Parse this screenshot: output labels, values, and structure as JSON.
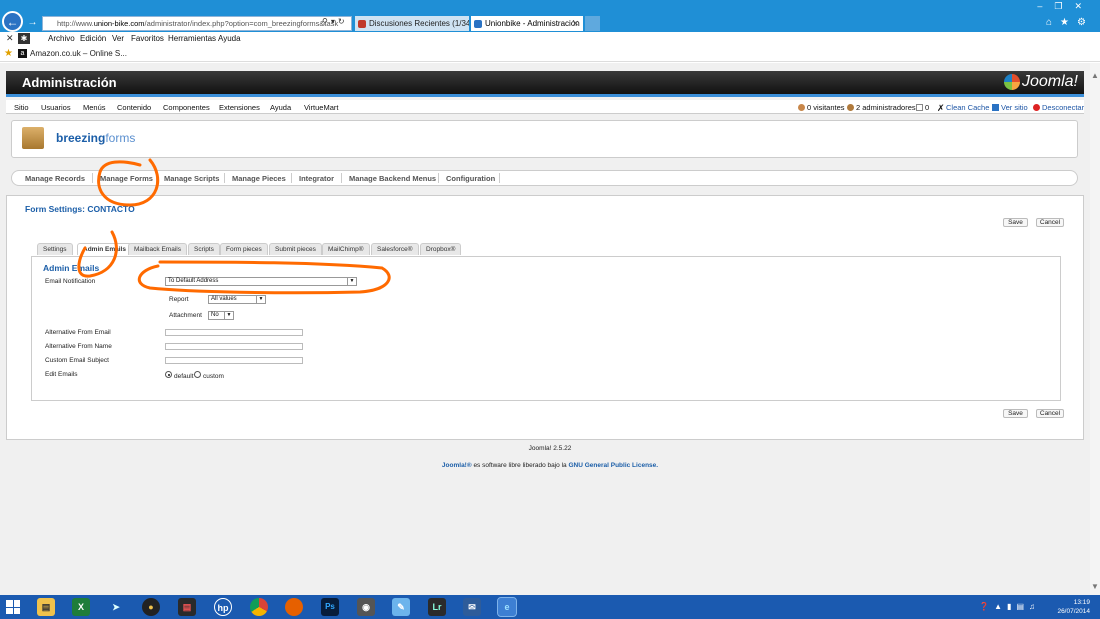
{
  "browser": {
    "url_prefix": "http://www.",
    "url_host": "union-bike.com",
    "url_rest": "/administrator/index.php?option=com_breezingforms&task",
    "tabs": [
      {
        "label": "Discusiones Recientes (1/34) - ..."
      },
      {
        "label": "Unionbike - Administración"
      }
    ],
    "menu": [
      "Archivo",
      "Edición",
      "Ver",
      "Favoritos",
      "Herramientas",
      "Ayuda"
    ],
    "favorite": "Amazon.co.uk – Online S..."
  },
  "admin": {
    "title": "Administración",
    "logo_text": "Joomla!",
    "nav": [
      "Sitio",
      "Usuarios",
      "Menús",
      "Contenido",
      "Componentes",
      "Extensiones",
      "Ayuda",
      "VirtueMart"
    ],
    "status": {
      "visitors": "0 visitantes",
      "admins": "2 administradores",
      "messages": "0",
      "clean_cache": "Clean Cache",
      "view_site": "Ver sitio",
      "logout": "Desconectar"
    }
  },
  "component": {
    "logo_bold": "breezing",
    "logo_thin": "forms",
    "subnav": [
      "Manage Records",
      "Manage Forms",
      "Manage Scripts",
      "Manage Pieces",
      "Integrator",
      "Manage Backend Menus",
      "Configuration"
    ]
  },
  "form": {
    "title": "Form Settings: CONTACTO",
    "save_label": "Save",
    "cancel_label": "Cancel",
    "tabs": [
      "Settings",
      "Admin Emails",
      "Mailback Emails",
      "Scripts",
      "Form pieces",
      "Submit pieces",
      "MailChimp®",
      "Salesforce®",
      "Dropbox®"
    ],
    "active_tab": "Admin Emails",
    "section_title": "Admin Emails",
    "fields": {
      "email_notification_label": "Email Notification",
      "email_notification_value": "To Default Address",
      "report_label": "Report",
      "report_value": "All values",
      "attachment_label": "Attachment",
      "attachment_value": "No",
      "alt_from_email_label": "Alternative From Email",
      "alt_from_email_value": "",
      "alt_from_name_label": "Alternative From Name",
      "alt_from_name_value": "",
      "custom_subject_label": "Custom Email Subject",
      "custom_subject_value": "",
      "edit_emails_label": "Edit Emails",
      "edit_emails_option_default": "default",
      "edit_emails_option_custom": "custom",
      "edit_emails_selected": "default"
    }
  },
  "footer": {
    "version": "Joomla! 2.5.22",
    "license_prefix": "Joomla!®",
    "license_middle": " es software libre liberado bajo la ",
    "license_link": "GNU General Public License."
  },
  "taskbar": {
    "time": "13:19",
    "date": "26/07/2014"
  },
  "colors": {
    "browser_blue": "#1f8fd6",
    "joomla_link": "#1b5ea8",
    "annotation_orange": "#ff6a00",
    "taskbar_blue": "#1b5ab0"
  }
}
